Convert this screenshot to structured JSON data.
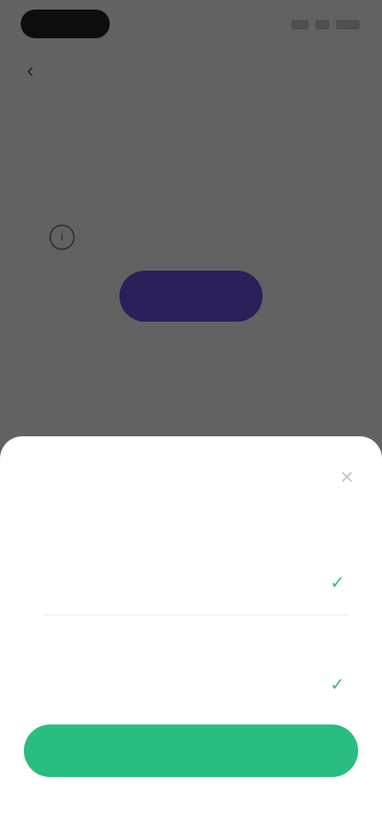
{
  "status_bar": {
    "time": "",
    "indicators": [
      "signal-icon",
      "wifi-icon",
      "battery-icon"
    ]
  },
  "nav": {
    "title": "",
    "back_icon": "chevron-left-icon"
  },
  "tabs": [
    {
      "label": "",
      "active": true
    },
    {
      "label": "",
      "active": false
    }
  ],
  "content": {
    "info_icon": "info-icon",
    "primary_button_label": "",
    "link_text": ""
  },
  "sheet": {
    "title": "",
    "close_icon": "close-icon",
    "fields": [
      {
        "label": "",
        "value": "",
        "check_icon": "check-icon"
      },
      {
        "label": "",
        "value": "",
        "check_icon": "check-icon"
      }
    ],
    "confirm_label": ""
  },
  "colors": {
    "primary_purple": "#6a4bd6",
    "confirm_green": "#29bd80",
    "check_green": "#46b97c",
    "overlay": "rgba(0,0,0,0.58)"
  }
}
